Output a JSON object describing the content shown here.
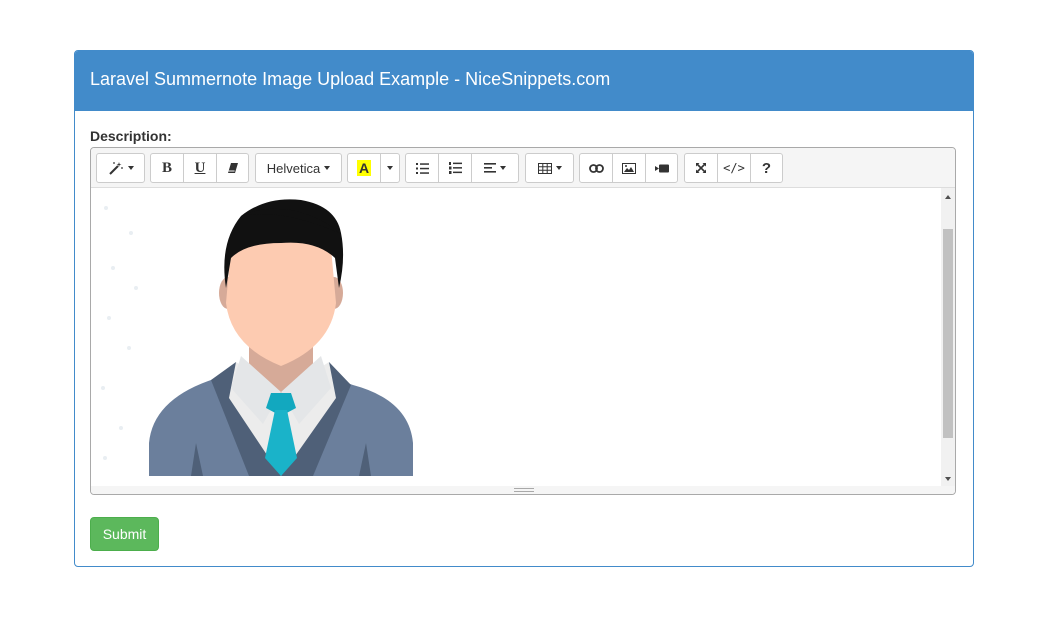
{
  "header": {
    "title": "Laravel Summernote Image Upload Example - NiceSnippets.com"
  },
  "form": {
    "description_label": "Description:",
    "submit_label": "Submit"
  },
  "toolbar": {
    "font_name": "Helvetica",
    "help_label": "?",
    "code_label": "</>",
    "bold_label": "B",
    "underline_label": "U",
    "color_label": "A"
  },
  "colors": {
    "panel_primary": "#428bca",
    "submit_green": "#5cb85c",
    "highlight_yellow": "#ffff00",
    "tie": "#1ab3c9",
    "suit": "#6b7f9c"
  },
  "icons": [
    "magic-icon",
    "eraser-icon",
    "unordered-list-icon",
    "ordered-list-icon",
    "align-icon",
    "table-icon",
    "link-icon",
    "picture-icon",
    "video-icon",
    "fullscreen-icon",
    "code-icon",
    "help-icon"
  ]
}
